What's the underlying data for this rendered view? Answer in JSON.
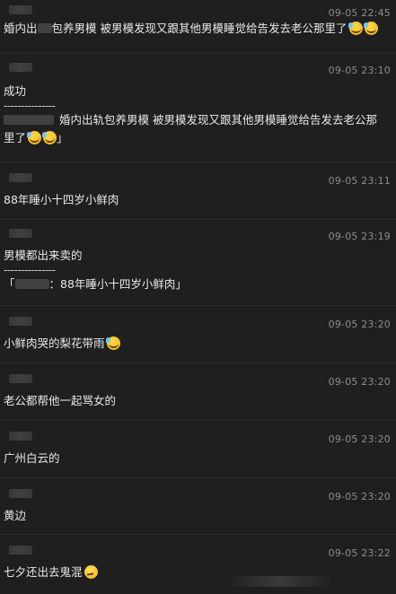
{
  "messages": [
    {
      "time": "09-05 22:45",
      "lines": [
        "婚内出",
        "包养男模 被男模发现又跟其他男模睡觉给告发去老公那里了"
      ],
      "emoji": [
        "face-with-sweat-icon",
        "face-with-sweat-icon"
      ]
    },
    {
      "time": "09-05 23:10",
      "text": "成功",
      "separator": "---------------",
      "quote_1": "婚内出轨包养男模 被男模发现又跟其他男模睡觉给告发去老公那",
      "quote_2": "里了",
      "quote_end": "」"
    },
    {
      "time": "09-05 23:11",
      "text": "88年睡小十四岁小鲜肉"
    },
    {
      "time": "09-05 23:19",
      "text": "男模都出来卖的",
      "separator": "---------------",
      "quote_start": "「",
      "quote_text": "：88年睡小十四岁小鲜肉」"
    },
    {
      "time": "09-05 23:20",
      "text": "小鲜肉哭的梨花带雨"
    },
    {
      "time": "09-05 23:20",
      "text": "老公都帮他一起骂女的"
    },
    {
      "time": "09-05 23:20",
      "text": "广州白云的"
    },
    {
      "time": "09-05 23:20",
      "text": "黄边"
    },
    {
      "time": "09-05 23:22",
      "text": "七夕还出去鬼混"
    }
  ],
  "colors": {
    "background": "#1f1f1f",
    "text": "#e8e8e8",
    "time": "#8c8c8c",
    "divider": "#2c2c2c"
  }
}
